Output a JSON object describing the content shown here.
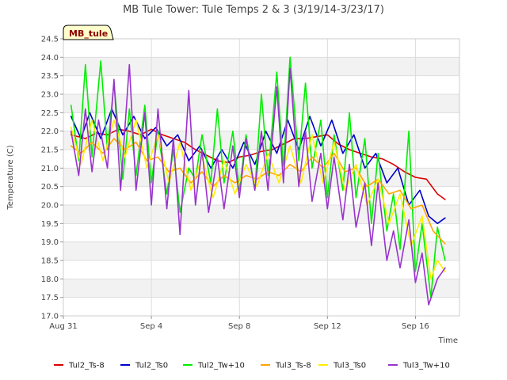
{
  "chart_data": {
    "type": "line",
    "title": "MB Tule Tower: Tule Temps 2 & 3 (3/19/14-3/23/17)",
    "badge": "MB_tule",
    "xlabel": "Time",
    "ylabel": "Temperature (C)",
    "x_unit": "days since Aug 31",
    "xlim": [
      0,
      18
    ],
    "ylim": [
      17.0,
      24.5
    ],
    "yticks": [
      17.0,
      17.5,
      18.0,
      18.5,
      19.0,
      19.5,
      20.0,
      20.5,
      21.0,
      21.5,
      22.0,
      22.5,
      23.0,
      23.5,
      24.0,
      24.5
    ],
    "ytick_labels": [
      "17.0",
      "17.5",
      "18.0",
      "18.5",
      "19.0",
      "19.5",
      "20.0",
      "20.5",
      "21.0",
      "21.5",
      "22.0",
      "22.5",
      "23.0",
      "23.5",
      "24.0",
      "24.5"
    ],
    "xticks": [
      0,
      4,
      8,
      12,
      16
    ],
    "xtick_labels": [
      "Aug 31",
      "Sep 4",
      "Sep 8",
      "Sep 12",
      "Sep 16"
    ],
    "grid": true,
    "legend_position": "bottom",
    "series": [
      {
        "name": "Tul2_Ts-8",
        "color": "#dd0000",
        "x": [
          0.35,
          1,
          1.5,
          2,
          2.5,
          3,
          3.5,
          4,
          4.5,
          5,
          5.5,
          6,
          6.5,
          7,
          7.5,
          8,
          8.5,
          9,
          9.5,
          10,
          10.5,
          11,
          11.5,
          12,
          12.5,
          13,
          13.5,
          14,
          14.5,
          15,
          15.5,
          16,
          16.5,
          17,
          17.35
        ],
        "y": [
          21.9,
          21.8,
          21.95,
          21.9,
          22.05,
          22.0,
          21.9,
          22.05,
          21.9,
          21.8,
          21.7,
          21.5,
          21.35,
          21.2,
          21.15,
          21.3,
          21.35,
          21.45,
          21.5,
          21.65,
          21.8,
          21.8,
          21.85,
          21.9,
          21.65,
          21.5,
          21.4,
          21.3,
          21.25,
          21.1,
          20.9,
          20.75,
          20.7,
          20.3,
          20.15
        ]
      },
      {
        "name": "Tul2_Ts0",
        "color": "#0000cc",
        "x": [
          0.35,
          0.8,
          1.2,
          1.7,
          2.2,
          2.7,
          3.2,
          3.7,
          4.2,
          4.7,
          5.2,
          5.7,
          6.2,
          6.7,
          7.2,
          7.7,
          8.2,
          8.7,
          9.2,
          9.7,
          10.2,
          10.7,
          11.2,
          11.7,
          12.2,
          12.7,
          13.2,
          13.7,
          14.2,
          14.7,
          15.2,
          15.7,
          16.2,
          16.6,
          17.0,
          17.35
        ],
        "y": [
          22.4,
          21.8,
          22.5,
          21.8,
          22.6,
          21.9,
          22.4,
          21.8,
          22.1,
          21.6,
          21.9,
          21.2,
          21.6,
          21.0,
          21.5,
          21.0,
          21.7,
          21.1,
          22.0,
          21.4,
          22.3,
          21.5,
          22.4,
          21.6,
          22.3,
          21.4,
          21.9,
          21.0,
          21.4,
          20.6,
          21.0,
          20.0,
          20.4,
          19.7,
          19.5,
          19.65
        ]
      },
      {
        "name": "Tul2_Tw+10",
        "color": "#00ee00",
        "x": [
          0.35,
          0.7,
          1.0,
          1.3,
          1.7,
          2.0,
          2.3,
          2.7,
          3.0,
          3.3,
          3.7,
          4.0,
          4.3,
          4.7,
          5.0,
          5.3,
          5.7,
          6.0,
          6.3,
          6.7,
          7.0,
          7.3,
          7.7,
          8.0,
          8.3,
          8.7,
          9.0,
          9.3,
          9.7,
          10.0,
          10.3,
          10.7,
          11.0,
          11.3,
          11.7,
          12.0,
          12.3,
          12.7,
          13.0,
          13.3,
          13.7,
          14.0,
          14.3,
          14.7,
          15.0,
          15.3,
          15.7,
          16.0,
          16.3,
          16.7,
          17.0,
          17.35
        ],
        "y": [
          22.7,
          21.2,
          23.8,
          21.3,
          23.9,
          21.5,
          23.3,
          20.7,
          22.6,
          20.8,
          22.7,
          20.6,
          22.0,
          20.3,
          21.5,
          19.8,
          21.0,
          20.7,
          21.9,
          20.6,
          22.6,
          20.6,
          22.0,
          20.4,
          21.9,
          20.4,
          23.0,
          20.8,
          23.6,
          21.0,
          24.0,
          21.2,
          23.3,
          21.0,
          22.3,
          20.2,
          21.9,
          20.4,
          22.5,
          20.2,
          21.8,
          19.5,
          21.4,
          19.3,
          20.3,
          18.8,
          22.0,
          18.2,
          19.5,
          17.5,
          19.4,
          18.5
        ]
      },
      {
        "name": "Tul3_Ts-8",
        "color": "#ffa500",
        "x": [
          0.35,
          0.8,
          1.3,
          1.8,
          2.3,
          2.8,
          3.3,
          3.8,
          4.3,
          4.8,
          5.3,
          5.8,
          6.3,
          6.8,
          7.3,
          7.8,
          8.3,
          8.8,
          9.3,
          9.8,
          10.3,
          10.8,
          11.3,
          11.8,
          12.3,
          12.8,
          13.3,
          13.8,
          14.3,
          14.8,
          15.3,
          15.8,
          16.3,
          16.8,
          17.35
        ],
        "y": [
          21.6,
          21.4,
          21.7,
          21.4,
          21.8,
          21.5,
          21.7,
          21.2,
          21.3,
          20.9,
          21.0,
          20.6,
          20.9,
          20.5,
          20.8,
          20.6,
          20.8,
          20.7,
          20.9,
          20.8,
          21.1,
          20.9,
          21.3,
          21.0,
          21.4,
          20.9,
          21.0,
          20.5,
          20.7,
          20.3,
          20.4,
          19.9,
          20.0,
          19.3,
          18.95
        ]
      },
      {
        "name": "Tul3_Ts0",
        "color": "#ffee00",
        "x": [
          0.35,
          0.8,
          1.3,
          1.8,
          2.3,
          2.8,
          3.3,
          3.8,
          4.3,
          4.8,
          5.3,
          5.8,
          6.3,
          6.8,
          7.3,
          7.8,
          8.3,
          8.8,
          9.3,
          9.8,
          10.3,
          10.8,
          11.3,
          11.8,
          12.3,
          12.8,
          13.3,
          13.8,
          14.3,
          14.8,
          15.3,
          15.8,
          16.3,
          16.7,
          17.0,
          17.35
        ],
        "y": [
          22.1,
          21.1,
          22.3,
          21.2,
          22.3,
          21.3,
          22.3,
          21.0,
          21.9,
          20.6,
          21.7,
          20.4,
          21.3,
          20.2,
          21.2,
          20.3,
          21.1,
          20.5,
          21.4,
          20.6,
          21.6,
          20.6,
          21.9,
          20.6,
          21.7,
          20.4,
          21.1,
          20.0,
          20.7,
          19.5,
          20.3,
          18.9,
          19.7,
          18.0,
          18.5,
          18.2
        ]
      },
      {
        "name": "Tul3_Tw+10",
        "color": "#9933cc",
        "x": [
          0.35,
          0.7,
          1.0,
          1.3,
          1.6,
          2.0,
          2.3,
          2.6,
          3.0,
          3.3,
          3.7,
          4.0,
          4.3,
          4.7,
          5.0,
          5.3,
          5.7,
          6.0,
          6.3,
          6.6,
          7.0,
          7.3,
          7.7,
          8.0,
          8.3,
          8.7,
          9.0,
          9.3,
          9.7,
          10.0,
          10.3,
          10.7,
          11.0,
          11.3,
          11.7,
          12.0,
          12.3,
          12.7,
          13.0,
          13.3,
          13.7,
          14.0,
          14.3,
          14.7,
          15.0,
          15.3,
          15.7,
          16.0,
          16.3,
          16.6,
          17.0,
          17.35
        ],
        "y": [
          22.0,
          20.8,
          22.6,
          20.9,
          22.3,
          21.0,
          23.4,
          20.4,
          23.8,
          20.4,
          22.5,
          20.0,
          22.6,
          19.9,
          21.8,
          19.2,
          23.1,
          20.0,
          21.5,
          19.8,
          21.3,
          19.9,
          21.6,
          20.2,
          21.8,
          20.4,
          22.0,
          20.4,
          23.2,
          20.6,
          23.7,
          20.5,
          22.0,
          20.1,
          21.4,
          19.9,
          21.3,
          19.6,
          21.1,
          19.4,
          20.6,
          18.9,
          20.6,
          18.5,
          19.3,
          18.3,
          19.6,
          17.9,
          18.7,
          17.3,
          18.0,
          18.3
        ]
      }
    ]
  }
}
